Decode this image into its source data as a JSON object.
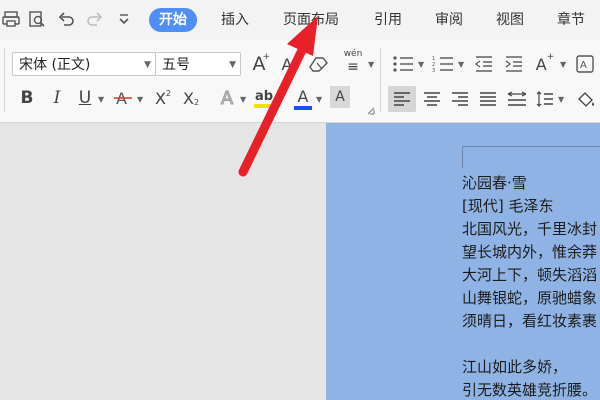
{
  "menu": {
    "tabs": [
      "开始",
      "插入",
      "页面布局",
      "引用",
      "审阅",
      "视图",
      "章节"
    ],
    "active_tab": "开始"
  },
  "ribbon": {
    "font_name": "宋体 (正文)",
    "font_size": "五号",
    "pinyin_label": "wén"
  },
  "document": {
    "lines": [
      "沁园春·雪",
      "[现代] 毛泽东",
      "北国风光，千里冰封",
      "望长城内外，惟余莽",
      "大河上下，顿失滔滔",
      "山舞银蛇，原驰蜡象",
      "须晴日，看红妆素裹",
      "",
      "江山如此多娇，",
      "引无数英雄竞折腰。"
    ]
  },
  "colors": {
    "active_tab": "#4f8ef5",
    "page": "#8fb3e4",
    "arrow": "#e8202a",
    "font_color_bar": "#1b4ef0",
    "highlight_bar": "#f5e000",
    "strike_color": "#e03030"
  }
}
